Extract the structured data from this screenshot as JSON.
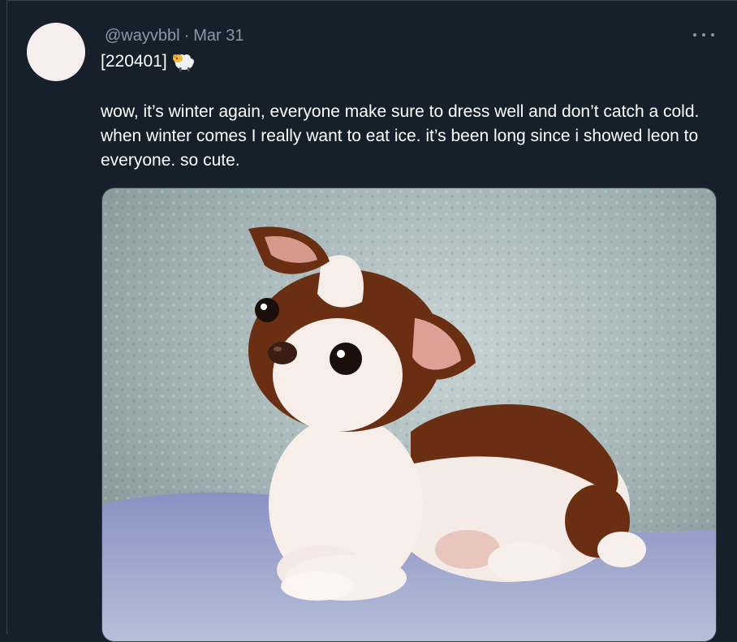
{
  "tweet": {
    "handle": "@wayvbbl",
    "separator": "·",
    "date": "Mar 31",
    "code_line": "[220401]",
    "emoji_icon": "sheep-emoji",
    "text": "wow, it’s winter again, everyone make sure to dress well and don’t catch a cold. when winter comes I really want to eat ice. it’s been long since i showed leon to everyone. so cute.",
    "more_icon": "more-options-icon",
    "media": {
      "subject": "puppy photo"
    }
  },
  "colors": {
    "background": "#15202b",
    "border": "#38444d",
    "secondary_text": "#8b98a5",
    "primary_text": "#ffffff",
    "avatar": "#f7efee"
  }
}
